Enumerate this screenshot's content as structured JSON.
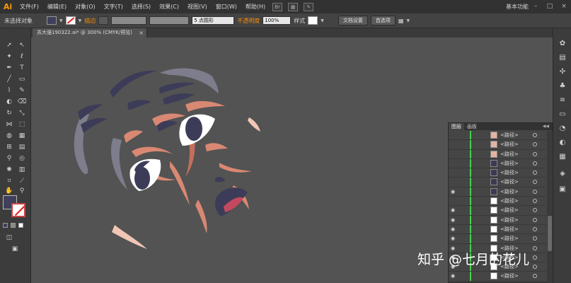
{
  "menubar": {
    "logo": "Ai",
    "items": [
      "文件(F)",
      "编辑(E)",
      "对象(O)",
      "文字(T)",
      "选择(S)",
      "效果(C)",
      "视图(V)",
      "窗口(W)",
      "帮助(H)"
    ],
    "workspace": "基本功能",
    "window_controls": [
      "–",
      "□",
      "×"
    ]
  },
  "controlbar": {
    "selection_status": "未选择对象",
    "stroke_label": "描边",
    "brush_size": "5 点圆形",
    "opacity_label": "不透明度",
    "opacity_value": "100%",
    "style_label": "样式",
    "doc_setup": "文档设置",
    "preferences": "首选项"
  },
  "document": {
    "tab_title": "苏大强190322.ai* @ 300% (CMYK/预览)",
    "close": "×"
  },
  "colors": {
    "fill": "#403f5c",
    "accent_orange": "#ff9a00",
    "layer_line": "#47d24d"
  },
  "layers_panel": {
    "tabs": [
      "图层",
      "画板"
    ],
    "rows": [
      {
        "name": "<路径>",
        "eye": false,
        "thumb": "#e4b3a2"
      },
      {
        "name": "<路径>",
        "eye": false,
        "thumb": "#e4b3a2"
      },
      {
        "name": "<路径>",
        "eye": false,
        "thumb": "#e4b3a2"
      },
      {
        "name": "<路径>",
        "eye": false,
        "thumb": "#3b3a55"
      },
      {
        "name": "<路径>",
        "eye": false,
        "thumb": "#3b3a55"
      },
      {
        "name": "<路径>",
        "eye": false,
        "thumb": "#3b3a55"
      },
      {
        "name": "<路径>",
        "eye": true,
        "thumb": "#3b3a55"
      },
      {
        "name": "<路径>",
        "eye": false,
        "thumb": "#ffffff"
      },
      {
        "name": "<路径>",
        "eye": true,
        "thumb": "#ffffff"
      },
      {
        "name": "<路径>",
        "eye": true,
        "thumb": "#ffffff"
      },
      {
        "name": "<路径>",
        "eye": true,
        "thumb": "#ffffff"
      },
      {
        "name": "<路径>",
        "eye": true,
        "thumb": "#ffffff"
      },
      {
        "name": "<路径>",
        "eye": true,
        "thumb": "#ffffff"
      },
      {
        "name": "<路径>",
        "eye": true,
        "thumb": "#ffffff"
      },
      {
        "name": "<路径>",
        "eye": true,
        "thumb": "#ffffff"
      },
      {
        "name": "<路径>",
        "eye": true,
        "thumb": "#ffffff"
      }
    ]
  },
  "watermark": "知乎 @七月的花儿"
}
